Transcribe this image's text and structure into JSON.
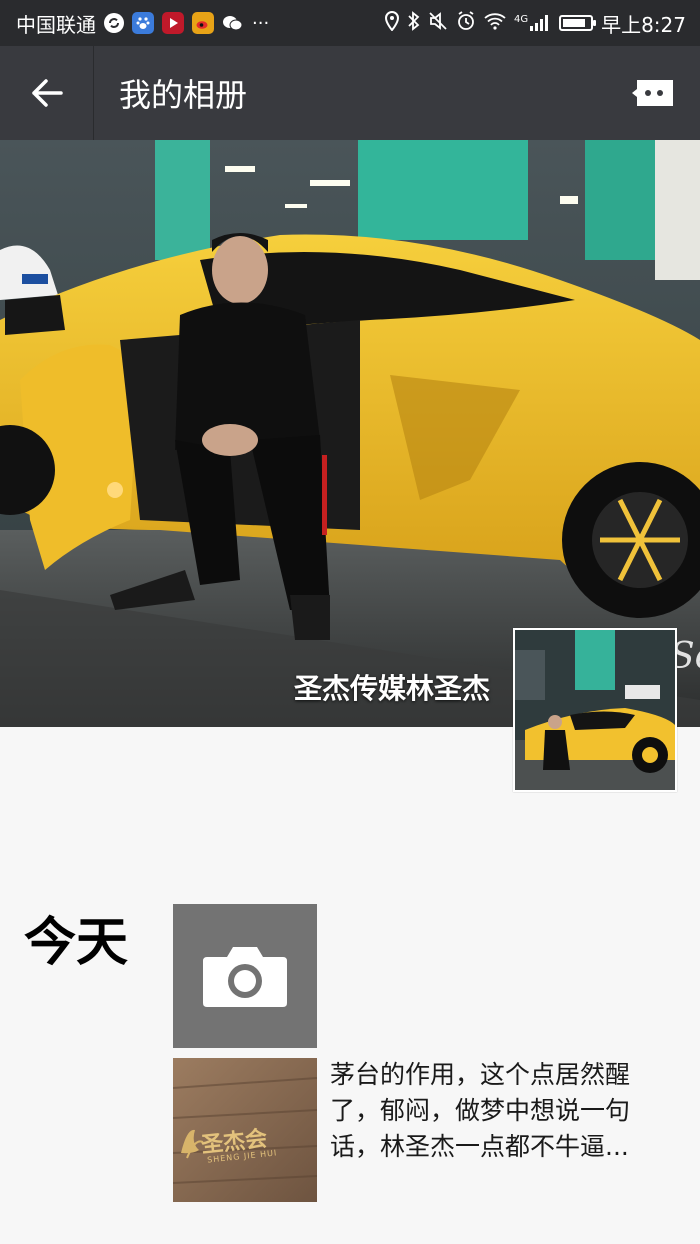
{
  "status_bar": {
    "carrier": "中国联通",
    "network": "4G",
    "time": "早上8:27",
    "battery_level": 0.85,
    "left_icons": [
      "sync-icon",
      "baidu-paw-icon",
      "video-player-icon",
      "weibo-icon",
      "wechat-icon"
    ],
    "overflow": "···"
  },
  "nav": {
    "title": "我的相册"
  },
  "profile": {
    "name": "圣杰传媒林圣杰"
  },
  "timeline": {
    "day_label": "今天",
    "post": {
      "text": "茅台的作用，这个点居然醒了，郁闷，做梦中想说一句话，林圣杰一点都不牛逼...",
      "thumb_logo_text": "圣杰会",
      "thumb_logo_sub": "SHENG JIE HUI"
    }
  },
  "colors": {
    "status_bar_bg": "#2a2b2e",
    "nav_bg": "#393a3f",
    "page_bg": "#f7f7f7",
    "car_yellow": "#f2c12e",
    "camera_tile_bg": "#737373"
  }
}
